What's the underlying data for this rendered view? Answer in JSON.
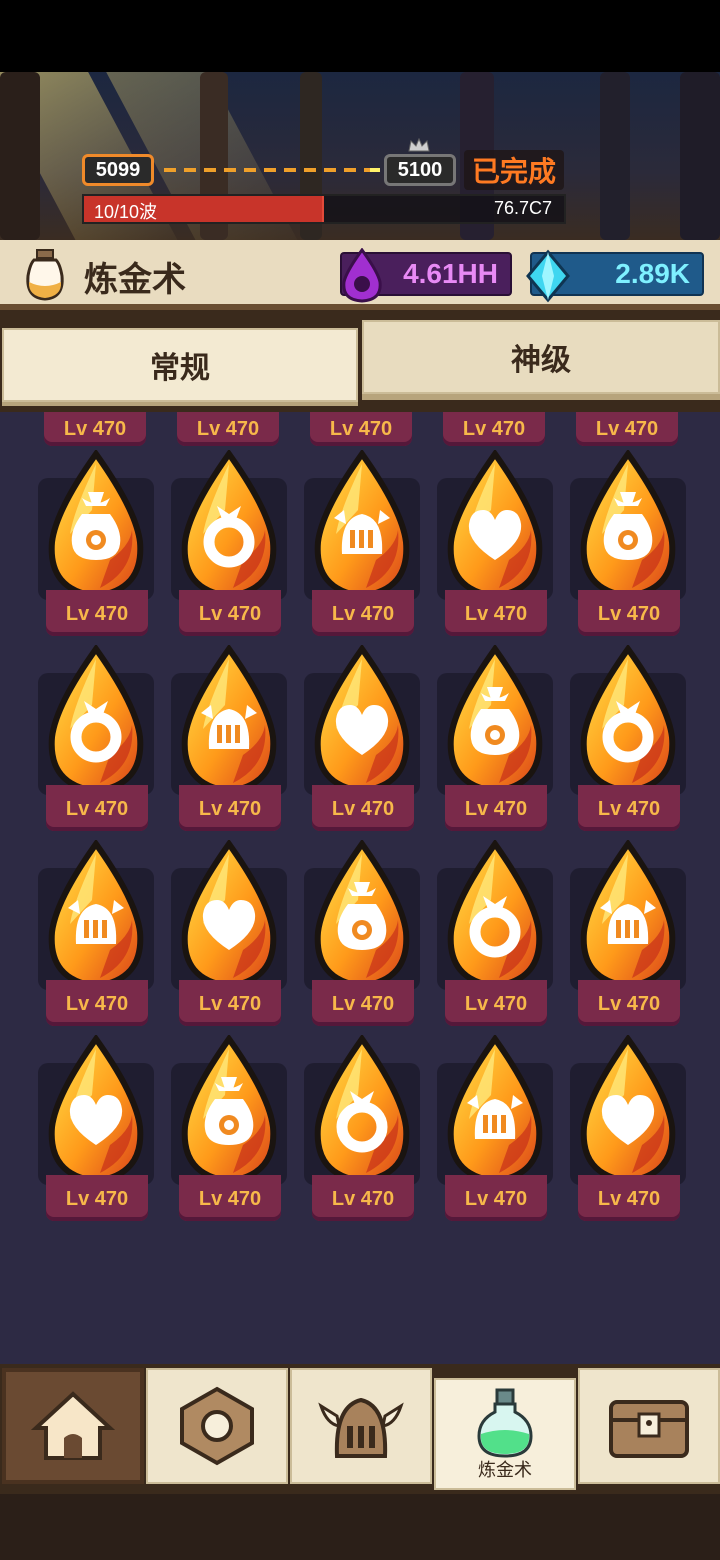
{
  "wave": {
    "current_stage": "5099",
    "next_stage": "5100",
    "status": "已完成",
    "progress_label": "10/10波",
    "progress_fraction": 0.5,
    "boss_hp": "76.7C7"
  },
  "header": {
    "title": "炼金术",
    "currency_purple": "4.61HH",
    "currency_blue": "2.89K"
  },
  "tabs": [
    {
      "label": "常规",
      "selected": false
    },
    {
      "label": "神级",
      "selected": true
    }
  ],
  "top_row_levels": [
    "Lv 470",
    "Lv 470",
    "Lv 470",
    "Lv 470",
    "Lv 470"
  ],
  "potions": [
    {
      "icon": "money-bag-icon",
      "level": "Lv 470"
    },
    {
      "icon": "ring-icon",
      "level": "Lv 470"
    },
    {
      "icon": "helmet-icon",
      "level": "Lv 470"
    },
    {
      "icon": "heart-icon",
      "level": "Lv 470"
    },
    {
      "icon": "money-bag-icon",
      "level": "Lv 470"
    },
    {
      "icon": "ring-icon",
      "level": "Lv 470"
    },
    {
      "icon": "helmet-icon",
      "level": "Lv 470"
    },
    {
      "icon": "heart-icon",
      "level": "Lv 470"
    },
    {
      "icon": "money-bag-icon",
      "level": "Lv 470"
    },
    {
      "icon": "ring-icon",
      "level": "Lv 470"
    },
    {
      "icon": "helmet-icon",
      "level": "Lv 470"
    },
    {
      "icon": "heart-icon",
      "level": "Lv 470"
    },
    {
      "icon": "money-bag-icon",
      "level": "Lv 470"
    },
    {
      "icon": "ring-icon",
      "level": "Lv 470"
    },
    {
      "icon": "helmet-icon",
      "level": "Lv 470"
    },
    {
      "icon": "heart-icon",
      "level": "Lv 470"
    },
    {
      "icon": "money-bag-icon",
      "level": "Lv 470"
    },
    {
      "icon": "ring-icon",
      "level": "Lv 470"
    },
    {
      "icon": "helmet-icon",
      "level": "Lv 470"
    },
    {
      "icon": "heart-icon",
      "level": "Lv 470"
    }
  ],
  "bottom_nav": [
    {
      "icon": "home-icon",
      "label": ""
    },
    {
      "icon": "gear-nut-icon",
      "label": ""
    },
    {
      "icon": "viking-helmet-icon",
      "label": ""
    },
    {
      "icon": "potion-flask-icon",
      "label": "炼金术",
      "selected": true
    },
    {
      "icon": "treasure-chest-icon",
      "label": ""
    }
  ],
  "colors": {
    "accent_orange": "#ff7a22",
    "level_text": "#f7b84a",
    "level_plate": "#7a2a4a",
    "grid_bg": "#2d2a44"
  }
}
